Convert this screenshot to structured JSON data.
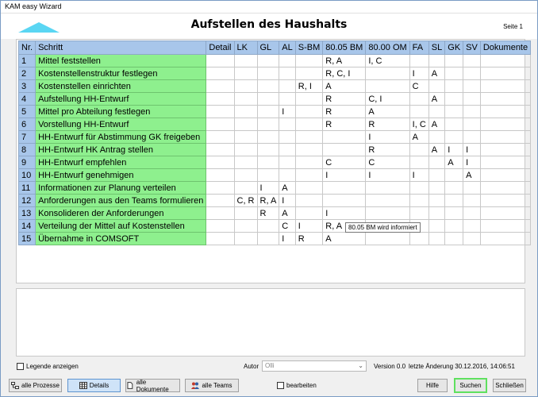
{
  "window": {
    "title": "KAM easy Wizard"
  },
  "header": {
    "heading": "Aufstellen des Haushalts",
    "page": "Seite 1"
  },
  "table": {
    "columns": [
      "Nr.",
      "Schritt",
      "Detail",
      "LK",
      "GL",
      "AL",
      "S-BM",
      "80.05 BM",
      "80.00 OM",
      "FA",
      "SL",
      "GK",
      "SV",
      "Dokumente"
    ],
    "rows": [
      [
        "1",
        "Mittel feststellen",
        "",
        "",
        "",
        "",
        "",
        "R, A",
        "I, C",
        "",
        "",
        "",
        "",
        ""
      ],
      [
        "2",
        "Kostenstellenstruktur festlegen",
        "",
        "",
        "",
        "",
        "",
        "R, C, I",
        "",
        "I",
        "A",
        "",
        "",
        ""
      ],
      [
        "3",
        "Kostenstellen einrichten",
        "",
        "",
        "",
        "",
        "R, I",
        "A",
        "",
        "C",
        "",
        "",
        "",
        ""
      ],
      [
        "4",
        "Aufstellung HH-Entwurf",
        "",
        "",
        "",
        "",
        "",
        "R",
        "C, I",
        "",
        "A",
        "",
        "",
        ""
      ],
      [
        "5",
        "Mittel pro Abteilung festlegen",
        "",
        "",
        "",
        "I",
        "",
        "R",
        "A",
        "",
        "",
        "",
        "",
        ""
      ],
      [
        "6",
        "Vorstellung HH-Entwurf",
        "",
        "",
        "",
        "",
        "",
        "R",
        "R",
        "I, C",
        "A",
        "",
        "",
        ""
      ],
      [
        "7",
        "HH-Entwurf für Abstimmung GK freigeben",
        "",
        "",
        "",
        "",
        "",
        "",
        "I",
        "A",
        "",
        "",
        "",
        ""
      ],
      [
        "8",
        "HH-Entwurf HK Antrag stellen",
        "",
        "",
        "",
        "",
        "",
        "",
        "R",
        "",
        "A",
        "I",
        "I",
        ""
      ],
      [
        "9",
        "HH-Entwurf empfehlen",
        "",
        "",
        "",
        "",
        "",
        "C",
        "C",
        "",
        "",
        "A",
        "I",
        ""
      ],
      [
        "10",
        "HH-Entwurf genehmigen",
        "",
        "",
        "",
        "",
        "",
        "I",
        "I",
        "I",
        "",
        "",
        "A",
        ""
      ],
      [
        "11",
        "Informationen zur Planung verteilen",
        "",
        "",
        "I",
        "A",
        "",
        "",
        "",
        "",
        "",
        "",
        "",
        ""
      ],
      [
        "12",
        "Anforderungen aus den Teams formulieren",
        "",
        "C, R",
        "R, A",
        "I",
        "",
        "",
        "",
        "",
        "",
        "",
        "",
        ""
      ],
      [
        "13",
        "Konsolideren der Anforderungen",
        "",
        "",
        "R",
        "A",
        "",
        "I",
        "",
        "",
        "",
        "",
        "",
        ""
      ],
      [
        "14",
        "Verteilung der Mittel auf Kostenstellen",
        "",
        "",
        "",
        "C",
        "I",
        "R, A",
        "",
        "",
        "",
        "",
        "",
        ""
      ],
      [
        "15",
        "Übernahme in COMSOFT",
        "",
        "",
        "",
        "I",
        "R",
        "A",
        "",
        "",
        "",
        "",
        "",
        ""
      ]
    ]
  },
  "tooltip": {
    "text": "80.05 BM wird informiert"
  },
  "footer": {
    "legend_label": "Legende anzeigen",
    "autor_label": "Autor",
    "autor_value": "Olli",
    "version": "Version 0.0",
    "last_changed": "letzte Änderung 30.12.2016, 14:06:51",
    "bearbeiten_label": "bearbeiten"
  },
  "buttons": {
    "alle_prozesse": "alle Prozesse",
    "details": "Details",
    "alle_dokumente": "alle Dokumente",
    "alle_teams": "alle Teams",
    "hilfe": "Hilfe",
    "suchen": "Suchen",
    "schliessen": "Schließen"
  },
  "colors": {
    "header_blue": "#a8c6ea",
    "step_green": "#8ef08e",
    "accent_cyan": "#5ad6f3",
    "focus_green": "#5fe05f"
  }
}
